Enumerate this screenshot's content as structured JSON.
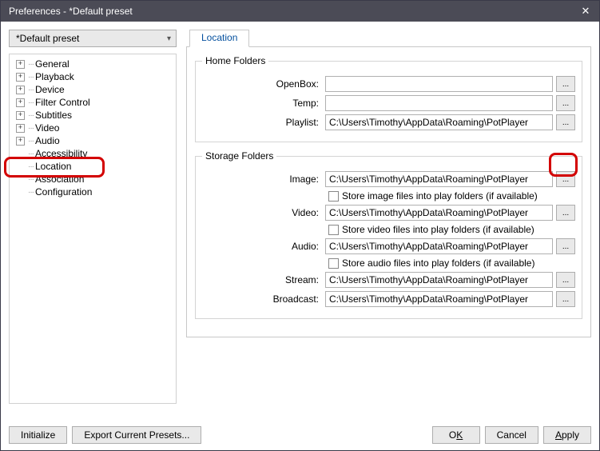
{
  "title": "Preferences - *Default preset",
  "preset_selected": "*Default preset",
  "tree": {
    "general": "General",
    "playback": "Playback",
    "device": "Device",
    "filter_control": "Filter Control",
    "subtitles": "Subtitles",
    "video": "Video",
    "audio": "Audio",
    "accessibility": "Accessibility",
    "location": "Location",
    "association": "Association",
    "configuration": "Configuration"
  },
  "tabs": {
    "location": "Location"
  },
  "home_folders": {
    "legend": "Home Folders",
    "openbox": {
      "label": "OpenBox:",
      "value": ""
    },
    "temp": {
      "label": "Temp:",
      "value": ""
    },
    "playlist": {
      "label": "Playlist:",
      "value": "C:\\Users\\Timothy\\AppData\\Roaming\\PotPlayer"
    }
  },
  "storage_folders": {
    "legend": "Storage Folders",
    "image": {
      "label": "Image:",
      "value": "C:\\Users\\Timothy\\AppData\\Roaming\\PotPlayer",
      "chk": "Store image files into play folders (if available)"
    },
    "video": {
      "label": "Video:",
      "value": "C:\\Users\\Timothy\\AppData\\Roaming\\PotPlayer",
      "chk": "Store video files into play folders (if available)"
    },
    "audio": {
      "label": "Audio:",
      "value": "C:\\Users\\Timothy\\AppData\\Roaming\\PotPlayer",
      "chk": "Store audio files into play folders (if available)"
    },
    "stream": {
      "label": "Stream:",
      "value": "C:\\Users\\Timothy\\AppData\\Roaming\\PotPlayer"
    },
    "broadcast": {
      "label": "Broadcast:",
      "value": "C:\\Users\\Timothy\\AppData\\Roaming\\PotPlayer"
    }
  },
  "browse_label": "...",
  "buttons": {
    "initialize": "Initialize",
    "export": "Export Current Presets...",
    "ok_pre": "O",
    "ok_u": "K",
    "cancel": "Cancel",
    "apply_u": "A",
    "apply_post": "pply"
  }
}
